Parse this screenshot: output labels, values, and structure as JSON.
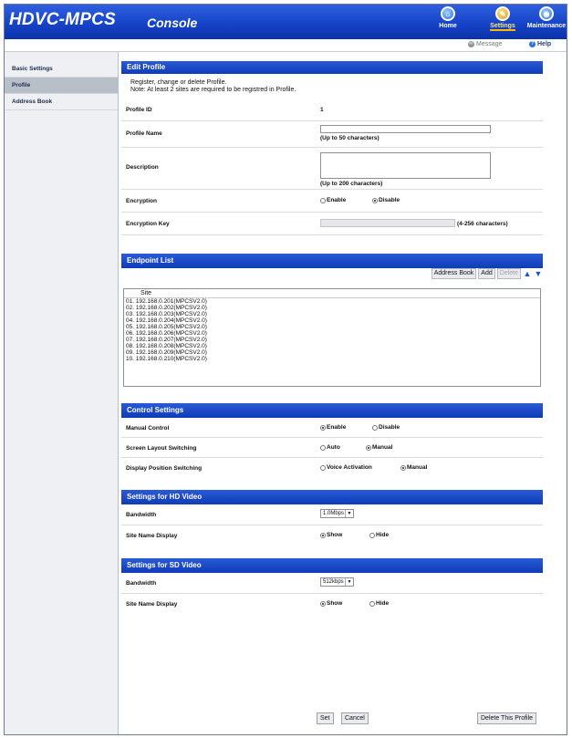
{
  "header": {
    "logo": "HDVC-MPCS",
    "console": "Console",
    "nav": [
      {
        "label": "Home",
        "icon": "home-icon"
      },
      {
        "label": "Settings",
        "icon": "settings-icon"
      },
      {
        "label": "Maintenance",
        "icon": "maintenance-icon"
      }
    ],
    "message_label": "Message",
    "help_label": "Help"
  },
  "sidebar": {
    "items": [
      {
        "label": "Basic Settings",
        "active": false
      },
      {
        "label": "Profile",
        "active": true
      },
      {
        "label": "Address Book",
        "active": false
      }
    ]
  },
  "edit_profile": {
    "title": "Edit Profile",
    "intro_line1": "Register, change or delete Profile.",
    "intro_line2": "Note: At least 2 sites are required to be registred in Profile.",
    "profile_id_label": "Profile ID",
    "profile_id_value": "1",
    "profile_name_label": "Profile Name",
    "profile_name_value": "",
    "profile_name_hint": "(Up to 50 characters)",
    "description_label": "Description",
    "description_value": "",
    "description_hint": "(Up to 200 characters)",
    "encryption_label": "Encryption",
    "encryption_enable": "Enable",
    "encryption_disable": "Disable",
    "encryption_selected": "Disable",
    "encryption_key_label": "Encryption Key",
    "encryption_key_value": "",
    "encryption_key_hint": "(4-256 characters)"
  },
  "endpoint_list": {
    "title": "Endpoint List",
    "toolbar": {
      "address_book": "Address Book",
      "add": "Add",
      "delete": "Delete"
    },
    "column_header": "Site",
    "items": [
      "01. 192.168.0.201(MPCSV2.0)",
      "02. 192.168.0.202(MPCSV2.0)",
      "03. 192.168.0.203(MPCSV2.0)",
      "04. 192.168.0.204(MPCSV2.0)",
      "05. 192.168.0.205(MPCSV2.0)",
      "06. 192.168.0.206(MPCSV2.0)",
      "07. 192.168.0.207(MPCSV2.0)",
      "08. 192.168.0.208(MPCSV2.0)",
      "09. 192.168.0.209(MPCSV2.0)",
      "10. 192.168.0.210(MPCSV2.0)"
    ]
  },
  "control_settings": {
    "title": "Control Settings",
    "manual_control_label": "Manual Control",
    "manual_control_enable": "Enable",
    "manual_control_disable": "Disable",
    "manual_control_selected": "Enable",
    "screen_layout_label": "Screen Layout Switching",
    "screen_layout_auto": "Auto",
    "screen_layout_manual": "Manual",
    "screen_layout_selected": "Manual",
    "display_position_label": "Display Position Switching",
    "display_position_voice": "Voice Activation",
    "display_position_manual": "Manual",
    "display_position_selected": "Manual"
  },
  "hd_video": {
    "title": "Settings for HD Video",
    "bandwidth_label": "Bandwidth",
    "bandwidth_value": "1.0Mbps",
    "site_name_label": "Site Name Display",
    "show": "Show",
    "hide": "Hide",
    "site_name_selected": "Show"
  },
  "sd_video": {
    "title": "Settings for SD Video",
    "bandwidth_label": "Bandwidth",
    "bandwidth_value": "512kbps",
    "site_name_label": "Site Name Display",
    "show": "Show",
    "hide": "Hide",
    "site_name_selected": "Show"
  },
  "footer": {
    "set": "Set",
    "cancel": "Cancel",
    "delete_profile": "Delete This Profile"
  },
  "colors": {
    "header_blue": "#1644c8",
    "section_bar_blue": "#1a48c4",
    "sidebar_bg": "#eef0f4",
    "active_sidebar": "#b9bfc9"
  }
}
